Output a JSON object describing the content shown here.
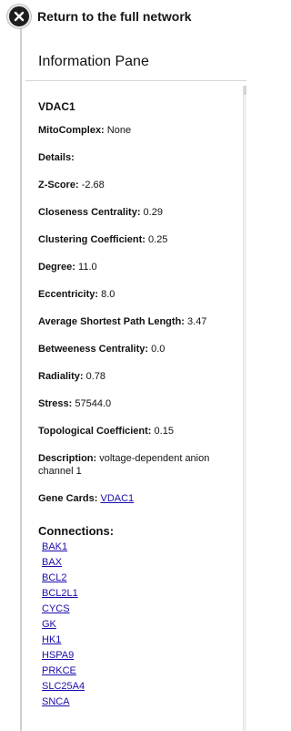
{
  "nav": {
    "return_label": "Return to the full network",
    "close_icon": "close-icon"
  },
  "pane": {
    "title": "Information Pane"
  },
  "gene": {
    "name": "VDAC1",
    "fields": [
      {
        "label": "MitoComplex:",
        "value": "None"
      },
      {
        "label": "Details:",
        "value": ""
      },
      {
        "label": "Z-Score:",
        "value": "-2.68"
      },
      {
        "label": "Closeness Centrality:",
        "value": "0.29"
      },
      {
        "label": "Clustering Coefficient:",
        "value": "0.25"
      },
      {
        "label": "Degree:",
        "value": "11.0"
      },
      {
        "label": "Eccentricity:",
        "value": "8.0"
      },
      {
        "label": "Average Shortest Path Length:",
        "value": "3.47"
      },
      {
        "label": "Betweeness Centrality:",
        "value": "0.0"
      },
      {
        "label": "Radiality:",
        "value": "0.78"
      },
      {
        "label": "Stress:",
        "value": "57544.0"
      },
      {
        "label": "Topological Coefficient:",
        "value": "0.15"
      },
      {
        "label": "Description:",
        "value": "voltage-dependent anion channel 1"
      }
    ],
    "gene_cards": {
      "label": "Gene Cards:",
      "link": "VDAC1"
    }
  },
  "connections": {
    "heading": "Connections:",
    "items": [
      "BAK1",
      "BAX",
      "BCL2",
      "BCL2L1",
      "CYCS",
      "GK",
      "HK1",
      "HSPA9",
      "PRKCE",
      "SLC25A4",
      "SNCA"
    ]
  }
}
